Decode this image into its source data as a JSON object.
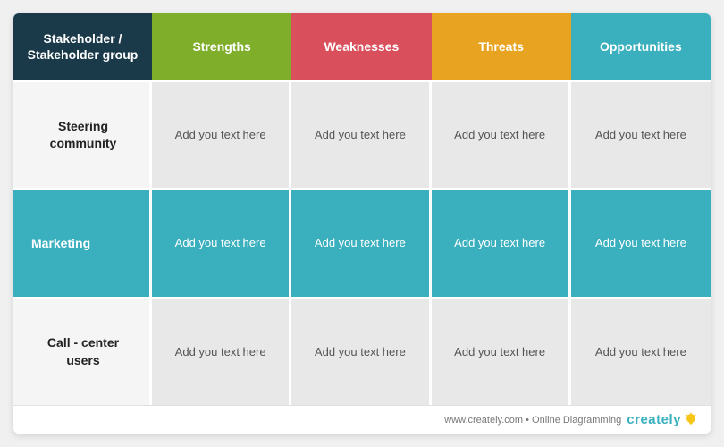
{
  "header": {
    "col0": "Stakeholder / Stakeholder group",
    "col1": "Strengths",
    "col2": "Weaknesses",
    "col3": "Threats",
    "col4": "Opportunities"
  },
  "rows": [
    {
      "id": "steering",
      "label": "Steering community",
      "highlight": false,
      "cells": [
        "Add you text here",
        "Add you text here",
        "Add you text here",
        "Add you text here"
      ]
    },
    {
      "id": "marketing",
      "label": "Marketing",
      "highlight": true,
      "cells": [
        "Add you text here",
        "Add you text here",
        "Add you text here",
        "Add you text here"
      ]
    },
    {
      "id": "callcenter",
      "label": "Call - center users",
      "highlight": false,
      "cells": [
        "Add you text here",
        "Add you text here",
        "Add you text here",
        "Add you text here"
      ]
    }
  ],
  "footer": {
    "url": "www.creately.com",
    "tagline": "www.creately.com • Online Diagramming",
    "brand": "creately"
  }
}
